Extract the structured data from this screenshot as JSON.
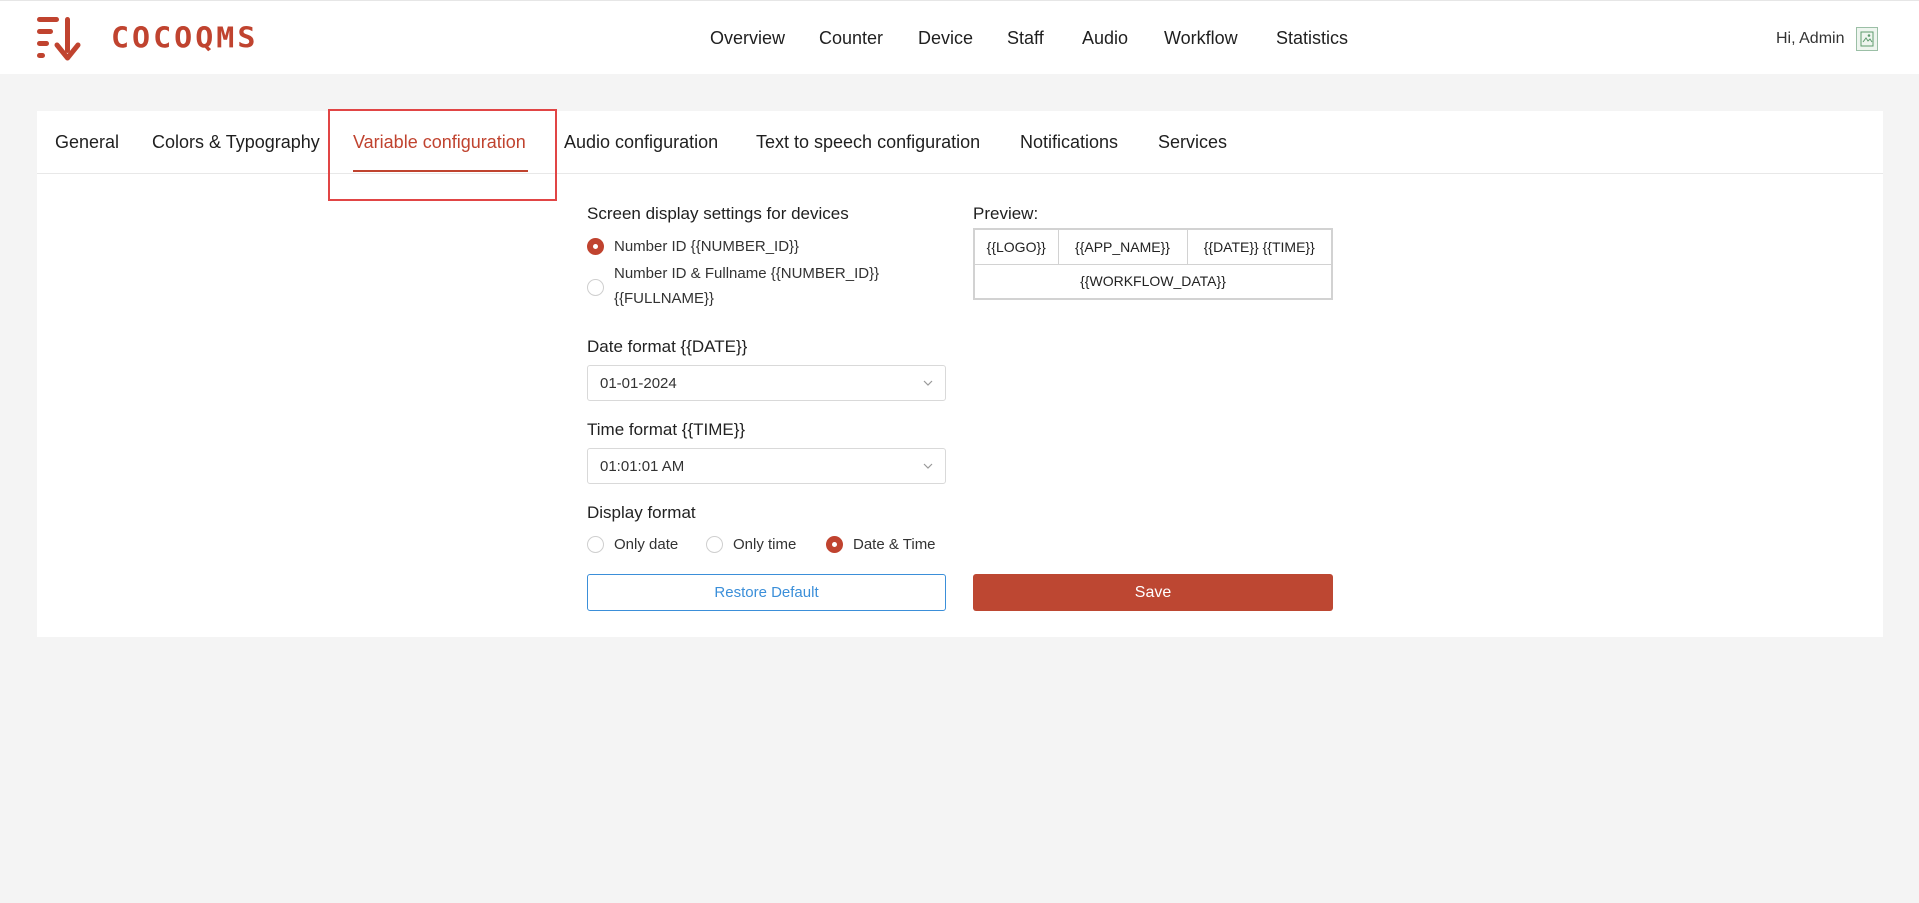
{
  "brand": {
    "name": "COCOQMS",
    "accent": "#c0432f"
  },
  "nav": {
    "items": [
      "Overview",
      "Counter",
      "Device",
      "Staff",
      "Audio",
      "Workflow",
      "Statistics"
    ]
  },
  "user": {
    "greeting": "Hi, Admin",
    "avatar_icon": "broken-image-icon"
  },
  "tabs": {
    "items": [
      "General",
      "Colors & Typography",
      "Variable configuration",
      "Audio configuration",
      "Text to speech configuration",
      "Notifications",
      "Services"
    ],
    "active": "Variable configuration"
  },
  "form": {
    "screen_display": {
      "label": "Screen display settings for devices",
      "options": [
        {
          "label": "Number ID {{NUMBER_ID}}",
          "checked": true
        },
        {
          "label_line1": "Number ID & Fullname {{NUMBER_ID}}",
          "label_line2": "{{FULLNAME}}",
          "checked": false
        }
      ]
    },
    "date_format": {
      "label": "Date format {{DATE}}",
      "value": "01-01-2024"
    },
    "time_format": {
      "label": "Time format {{TIME}}",
      "value": "01:01:01 AM"
    },
    "display_format": {
      "label": "Display format",
      "options": [
        {
          "label": "Only date",
          "checked": false
        },
        {
          "label": "Only time",
          "checked": false
        },
        {
          "label": "Date & Time",
          "checked": true
        }
      ]
    },
    "restore_label": "Restore Default",
    "save_label": "Save"
  },
  "preview": {
    "label": "Preview:",
    "row1": [
      "{{LOGO}}",
      "{{APP_NAME}}",
      "{{DATE}} {{TIME}}"
    ],
    "row2": "{{WORKFLOW_DATA}}"
  }
}
